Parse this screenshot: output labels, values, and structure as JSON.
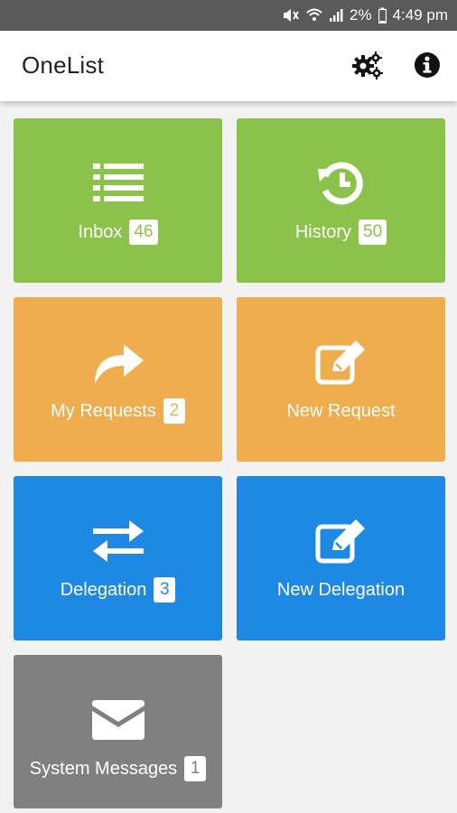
{
  "status_bar": {
    "battery": "2%",
    "time": "4:49 pm"
  },
  "app_bar": {
    "title": "OneList",
    "actions": [
      "settings-icon",
      "info-icon"
    ]
  },
  "tiles": [
    {
      "label": "Inbox",
      "badge": "46",
      "icon": "list-icon",
      "color": "#8bc34a"
    },
    {
      "label": "History",
      "badge": "50",
      "icon": "history-icon",
      "color": "#8bc34a"
    },
    {
      "label": "My Requests",
      "badge": "2",
      "icon": "share-arrow-icon",
      "color": "#f0ad4e"
    },
    {
      "label": "New Request",
      "icon": "edit-icon",
      "color": "#f0ad4e"
    },
    {
      "label": "Delegation",
      "badge": "3",
      "icon": "exchange-icon",
      "color": "#1e88e5"
    },
    {
      "label": "New Delegation",
      "icon": "edit-icon",
      "color": "#1e88e5"
    },
    {
      "label": "System Messages",
      "badge": "1",
      "icon": "envelope-icon",
      "color": "#808080"
    }
  ]
}
